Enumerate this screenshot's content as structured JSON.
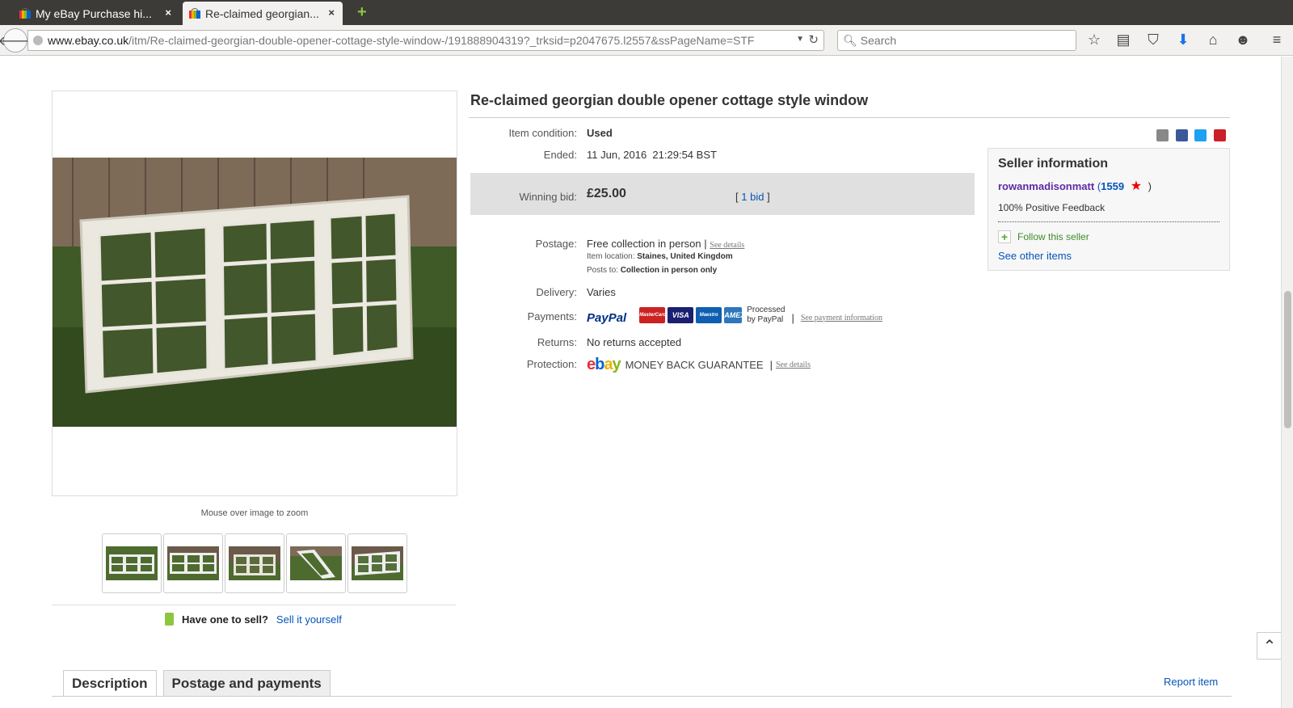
{
  "browser": {
    "tabs": [
      {
        "label": "My eBay Purchase hi...",
        "close": "×"
      },
      {
        "label": "Re-claimed georgian...",
        "close": "×"
      }
    ],
    "new_tab": "+",
    "url_domain": "www.ebay.co.uk",
    "url_path": "/itm/Re-claimed-georgian-double-opener-cottage-style-window-/191888904319?_trksid=p2047675.l2557&ssPageName=STF",
    "search_placeholder": "Search"
  },
  "listing": {
    "title": "Re-claimed georgian double opener cottage style window",
    "zoom_hint": "Mouse over image to zoom",
    "thumbnail_count": 5,
    "sell": {
      "question": "Have one to sell?",
      "link": "Sell it yourself"
    },
    "condition_label": "Item condition:",
    "condition_value": "Used",
    "ended_label": "Ended:",
    "ended_value": "11 Jun, 2016  21:29:54 BST",
    "winning_bid_label": "Winning bid:",
    "winning_bid_value": "£25.00",
    "bids_open": "[",
    "bids_link": "1 bid",
    "bids_close": "]",
    "postage_label": "Postage:",
    "postage_value": "Free collection in person",
    "postage_sep": "|",
    "postage_see_details": "See details",
    "location_label": "Item location:",
    "location_value": "Staines, United Kingdom",
    "posts_to_label": "Posts to:",
    "posts_to_value": "Collection in person only",
    "delivery_label": "Delivery:",
    "delivery_value": "Varies",
    "payments_label": "Payments:",
    "paypal": "PayPal",
    "processed": "Processed",
    "by_paypal": "by PayPal",
    "payments_sep": "|",
    "payment_info_link": "See payment information",
    "returns_label": "Returns:",
    "returns_value": "No returns accepted",
    "protection_label": "Protection:",
    "ebay_logo": "ebay",
    "guarantee": "MONEY BACK GUARANTEE",
    "protection_sep": "|",
    "protection_see_details": "See details"
  },
  "cards": [
    {
      "name": "MasterCard",
      "color": "#cc2222"
    },
    {
      "name": "VISA",
      "color": "#1a1f71"
    },
    {
      "name": "Maestro",
      "color": "#0e5fb0"
    },
    {
      "name": "AMEX",
      "color": "#2e77bb"
    }
  ],
  "seller": {
    "heading": "Seller information",
    "name": "rowanmadisonmatt",
    "feedback_open": "(",
    "feedback_count": "1559",
    "feedback_close": ")",
    "positive": "100% Positive Feedback",
    "follow": "Follow this seller",
    "other_items": "See other items"
  },
  "bottom_tabs": {
    "description": "Description",
    "postage": "Postage and payments",
    "report": "Report item"
  },
  "colors": {
    "link": "#0654ba",
    "seller": "#5d2ba3",
    "follow": "#3c8c2b"
  }
}
